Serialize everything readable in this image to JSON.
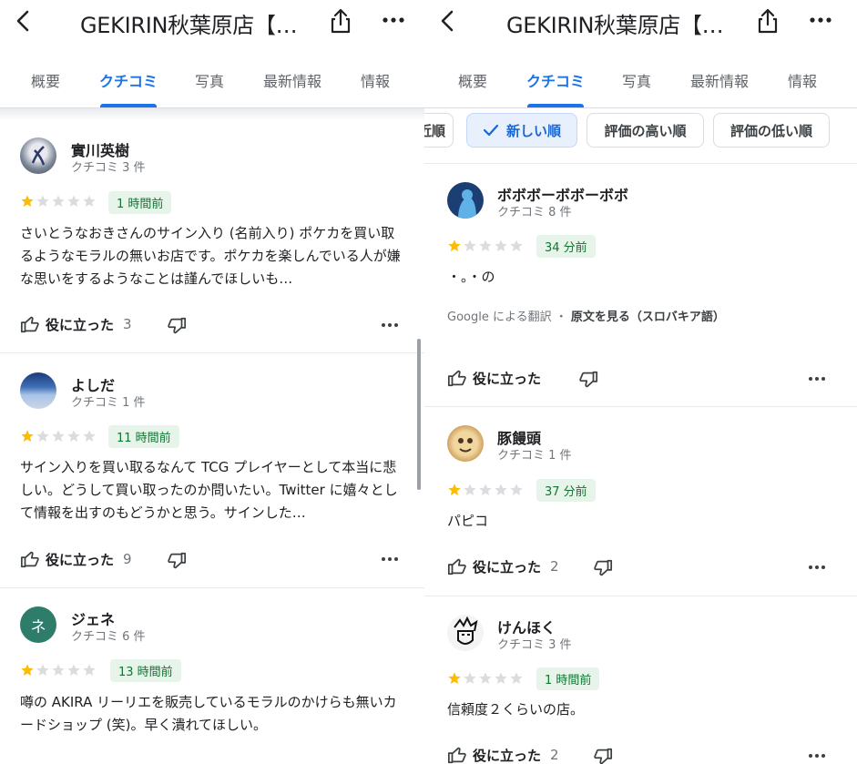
{
  "left": {
    "header": {
      "title": "GEKIRIN秋葉原店【…"
    },
    "tabs": [
      "概要",
      "クチコミ",
      "写真",
      "最新情報",
      "情報"
    ],
    "reviews": [
      {
        "name": "實川英樹",
        "count": "クチコミ 3 件",
        "rating": 1,
        "time": "1 時間前",
        "text": "さいとうなおきさんのサイン入り (名前入り) ポケカを買い取るようなモラルの無いお店です。ポケカを楽しんでいる人が嫌な思いをするようなことは謹んでほしいも…",
        "helpful_label": "役に立った",
        "helpful_count": "3"
      },
      {
        "name": "よしだ",
        "count": "クチコミ 1 件",
        "rating": 1,
        "time": "11 時間前",
        "text": "サイン入りを買い取るなんて TCG プレイヤーとして本当に悲しい。どうして買い取ったのか問いたい。Twitter に嬉々として情報を出すのもどうかと思う。サインした…",
        "helpful_label": "役に立った",
        "helpful_count": "9"
      },
      {
        "name": "ジェネ",
        "avatar_letter": "ネ",
        "count": "クチコミ 6 件",
        "rating": 1,
        "time": "13 時間前",
        "text": "噂の AKIRA リーリエを販売しているモラルのかけらも無いカードショップ (笑)。早く潰れてほしい。",
        "helpful_label": "役に立った",
        "helpful_count": ""
      }
    ]
  },
  "right": {
    "header": {
      "title": "GEKIRIN秋葉原店【…"
    },
    "tabs": [
      "概要",
      "クチコミ",
      "写真",
      "最新情報",
      "情報"
    ],
    "chips": [
      "近順",
      "新しい順",
      "評価の高い順",
      "評価の低い順"
    ],
    "reviews": [
      {
        "name": "ボボボーボボーボボ",
        "count": "クチコミ 8 件",
        "rating": 1,
        "time": "34 分前",
        "text": "・。・の",
        "translation_prefix": "Google による翻訳 ・",
        "translation_link": "原文を見る（スロバキア語）",
        "helpful_label": "役に立った",
        "helpful_count": ""
      },
      {
        "name": "豚饅頭",
        "count": "クチコミ 1 件",
        "rating": 1,
        "time": "37 分前",
        "text": "パピコ",
        "helpful_label": "役に立った",
        "helpful_count": "2"
      },
      {
        "name": "けんほく",
        "count": "クチコミ 3 件",
        "rating": 1,
        "time": "1 時間前",
        "text": "信頼度２くらいの店。",
        "helpful_label": "役に立った",
        "helpful_count": "2"
      }
    ]
  },
  "colors": {
    "accent": "#1a73e8",
    "star": "#fbbc04",
    "star_empty": "#dadce0",
    "badge_bg": "#e6f4ea",
    "badge_text": "#137333"
  },
  "icons": [
    "back-arrow-icon",
    "share-icon",
    "more-horizontal-icon",
    "thumbs-up-icon",
    "thumbs-down-icon",
    "check-icon",
    "star-icon"
  ]
}
